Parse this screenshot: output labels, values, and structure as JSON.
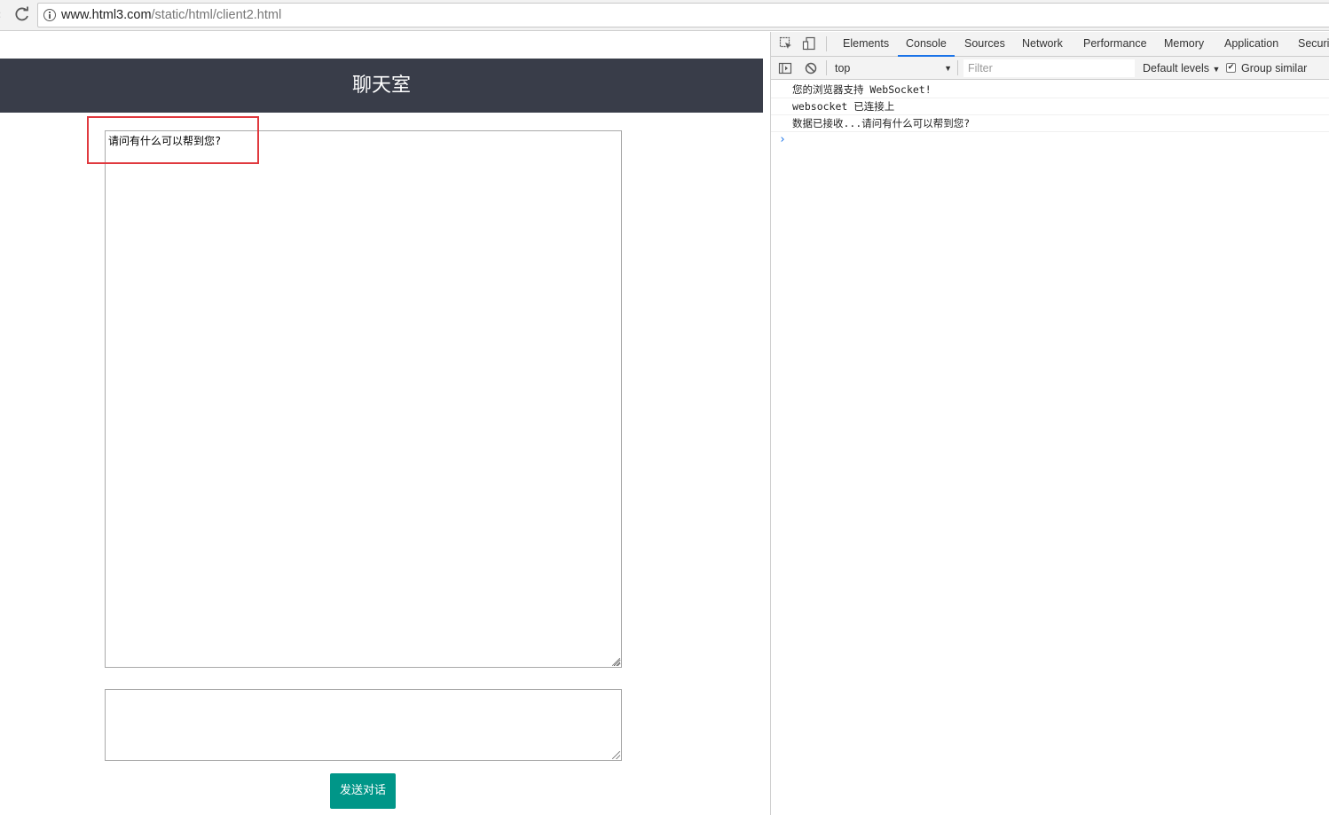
{
  "browser": {
    "url_host": "www.html3.com",
    "url_path": "/static/html/client2.html"
  },
  "page": {
    "title": "聊天室",
    "messages": [
      "请问有什么可以帮到您?"
    ],
    "input_value": "",
    "send_label": "发送对话",
    "colors": {
      "header": "#393d49",
      "button": "#009688",
      "highlight": "#e0393e"
    }
  },
  "devtools": {
    "tabs": [
      "Elements",
      "Console",
      "Sources",
      "Network",
      "Performance",
      "Memory",
      "Application",
      "Securi"
    ],
    "active_tab": "Console",
    "context": "top",
    "filter_placeholder": "Filter",
    "levels_label": "Default levels",
    "group_similar_label": "Group similar",
    "group_similar_checked": true,
    "console_lines": [
      "您的浏览器支持 WebSocket!",
      "websocket 已连接上",
      "数据已接收...请问有什么可以帮到您?"
    ]
  }
}
